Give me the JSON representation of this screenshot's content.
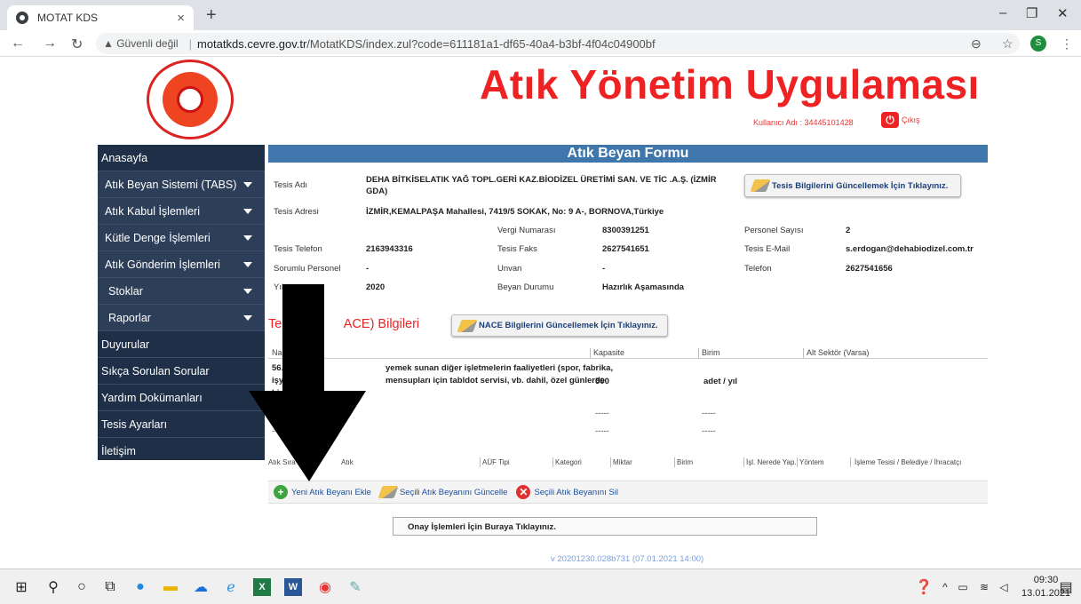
{
  "browser": {
    "tab_title": "MOTAT KDS",
    "tab_close": "×",
    "new_tab": "+",
    "warning": "▲ Güvenli değil",
    "url_host": "motatkds.cevre.gov.tr",
    "url_path": "/MotatKDS/index.zul?code=611181a1-df65-40a4-b3bf-4f04c04900bf",
    "avatar": "S",
    "min": "–",
    "max": "❐",
    "close": "✕"
  },
  "header": {
    "app_title": "Atık Yönetim Uygulaması",
    "user_label": "Kullanıcı Adı : 34445101428",
    "logout_label": "Çıkış"
  },
  "sidebar": {
    "items": [
      {
        "label": "Anasayfa"
      },
      {
        "label": "Atık Beyan Sistemi (TABS)"
      },
      {
        "label": "Atık Kabul İşlemleri"
      },
      {
        "label": "Kütle Denge İşlemleri"
      },
      {
        "label": "Atık Gönderim İşlemleri"
      },
      {
        "label": "Stoklar"
      },
      {
        "label": "Raporlar"
      },
      {
        "label": "Duyurular"
      },
      {
        "label": "Sıkça Sorulan Sorular"
      },
      {
        "label": "Yardım Dokümanları"
      },
      {
        "label": "Tesis Ayarları"
      },
      {
        "label": "İletişim"
      }
    ]
  },
  "form": {
    "title": "Atık Beyan Formu",
    "tesis_adi_label": "Tesis Adı",
    "tesis_adi_value": "DEHA BİTKİSELATIK YAĞ TOPL.GERİ KAZ.BİODİZEL ÜRETİMİ SAN. VE TİC .A.Ş. (İZMİR GDA)",
    "update_tesis_btn": "Tesis Bilgilerini Güncellemek İçin Tıklayınız.",
    "tesis_adresi_label": "Tesis Adresi",
    "tesis_adresi_value": "İZMİR,KEMALPAŞA Mahallesi, 7419/5 SOKAK, No: 9 A-, BORNOVA,Türkiye",
    "vergi_label": "Vergi Numarası",
    "vergi_value": "8300391251",
    "personel_sayisi_label": "Personel Sayısı",
    "personel_sayisi_value": "2",
    "tesis_telefon_label": "Tesis Telefon",
    "tesis_telefon_value": "2163943316",
    "tesis_faks_label": "Tesis Faks",
    "tesis_faks_value": "2627541651",
    "tesis_email_label": "Tesis E-Mail",
    "tesis_email_value": "s.erdogan@dehabiodizel.com.tr",
    "sorumlu_label": "Sorumlu Personel",
    "sorumlu_value": "-",
    "unvan_label": "Unvan",
    "unvan_value": "-",
    "telefon_label": "Telefon",
    "telefon_value": "2627541656",
    "yil_label": "Yıl",
    "yil_value": "2020",
    "beyan_durumu_label": "Beyan Durumu",
    "beyan_durumu_value": "Hazırlık Aşamasında"
  },
  "nace": {
    "header_left": "Tesis K",
    "header_right": "ACE) Bilgileri",
    "update_btn": "NACE Bilgilerini Güncellemek İçin Tıklayınız.",
    "columns": [
      "Nace",
      "Kapasite",
      "Birim",
      "Alt Sektör (Varsa)"
    ],
    "row1": {
      "nace_line1": "56.29.90",
      "nace_line1b": "yemek sunan diğer işletmelerin faaliyetleri (spor, fabrika,",
      "nace_line2a": "işyeri,",
      "nace_line2b": "mensupları için tabldot servisi, vb. dahil, özel günlerde",
      "nace_line3": "hizr",
      "kapasite": "500",
      "birim": "adet / yıl"
    },
    "dash": "-----"
  },
  "atik_table": {
    "columns": [
      "Atık Sıra No",
      "Atık",
      "AÜF Tipi",
      "Kategori",
      "Miktar",
      "Birim",
      "İşl. Nerede Yap.",
      "Yöntem",
      "İşleme Tesisi / Belediye / İhracatçı"
    ]
  },
  "actions": {
    "add": "Yeni Atık Beyanı Ekle",
    "update": "Seçili Atık Beyanını Güncelle",
    "delete": "Seçili Atık Beyanını Sil"
  },
  "onay_label": "Onay İşlemleri İçin Buraya Tıklayınız.",
  "version": "v 20201230.028b731 (07.01.2021 14:00)",
  "taskbar": {
    "time": "09:30",
    "date": "13.01.2021"
  }
}
